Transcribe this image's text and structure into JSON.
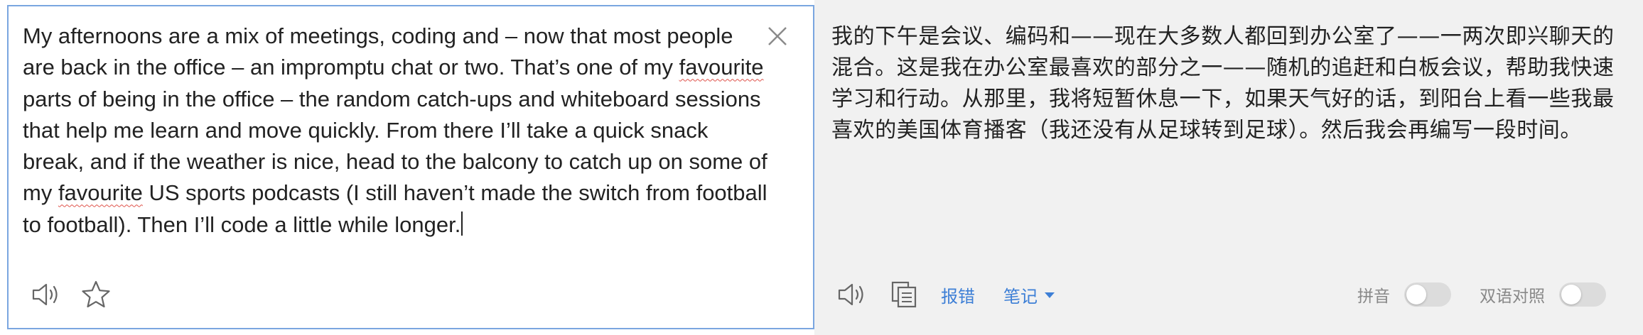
{
  "source": {
    "text_parts": [
      "My afternoons are a mix of meetings, coding and – now that most people are back in the office – an impromptu chat or two. That’s one of my ",
      "favourite",
      " parts of being in the office – the random catch-ups and whiteboard sessions that help me learn and move quickly. From there I’ll take a quick snack break, and if the weather is nice, head to the balcony to catch up on some of my ",
      "favourite",
      " US sports podcasts (I still haven’t made the switch from football to football). Then I’ll code a little while longer."
    ],
    "icons": {
      "close": "close-icon",
      "speaker": "speaker-icon",
      "favorite": "star-icon"
    }
  },
  "translation": {
    "text": "我的下午是会议、编码和——现在大多数人都回到办公室了——一两次即兴聊天的混合。这是我在办公室最喜欢的部分之一——随机的追赶和白板会议，帮助我快速学习和行动。从那里，我将短暂休息一下，如果天气好的话，到阳台上看一些我最喜欢的美国体育播客（我还没有从足球转到足球）。然后我会再编写一段时间。",
    "report_error_label": "报错",
    "notes_label": "笔记",
    "pinyin_label": "拼音",
    "bilingual_label": "双语对照",
    "icons": {
      "speaker": "speaker-icon",
      "copy": "copy-icon"
    }
  },
  "colors": {
    "accent": "#3d7fd6",
    "panel_border": "#7aa6e0",
    "translation_bg": "#f1f1f1"
  }
}
